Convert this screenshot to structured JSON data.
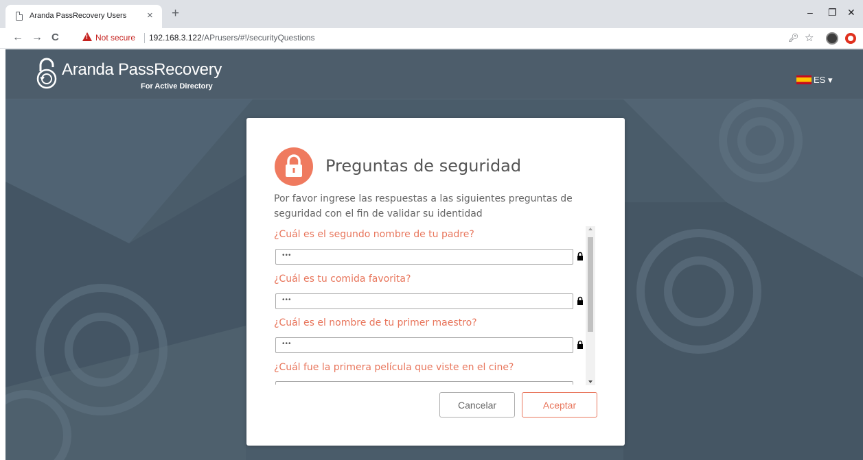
{
  "browser": {
    "tab_title": "Aranda PassRecovery Users",
    "tab_close": "×",
    "new_tab": "+",
    "minimize": "–",
    "restore": "❐",
    "close": "✕",
    "back": "←",
    "forward": "→",
    "reload": "C",
    "security_label": "Not secure",
    "url_host": "192.168.3.122",
    "url_path": "/APrusers/#!/securityQuestions"
  },
  "header": {
    "brand": "Aranda PassRecovery",
    "brand_sub": "For Active Directory",
    "language": "ES ▾"
  },
  "card": {
    "title": "Preguntas de seguridad",
    "intro": "Por favor ingrese las respuestas a las siguientes preguntas de seguridad con el fin de validar su identidad",
    "questions": [
      {
        "label": "¿Cuál es el segundo nombre de tu padre?",
        "answer": "•••"
      },
      {
        "label": "¿Cuál es tu comida favorita?",
        "answer": "•••"
      },
      {
        "label": "¿Cuál es el nombre de tu primer maestro?",
        "answer": "•••"
      },
      {
        "label": "¿Cuál fue la primera película que viste en el cine?",
        "answer": ""
      }
    ],
    "cancel_label": "Cancelar",
    "accept_label": "Aceptar"
  },
  "colors": {
    "accent": "#e8755b",
    "header_bg": "#4d5d6b",
    "page_bg": "#4a5c6a"
  }
}
